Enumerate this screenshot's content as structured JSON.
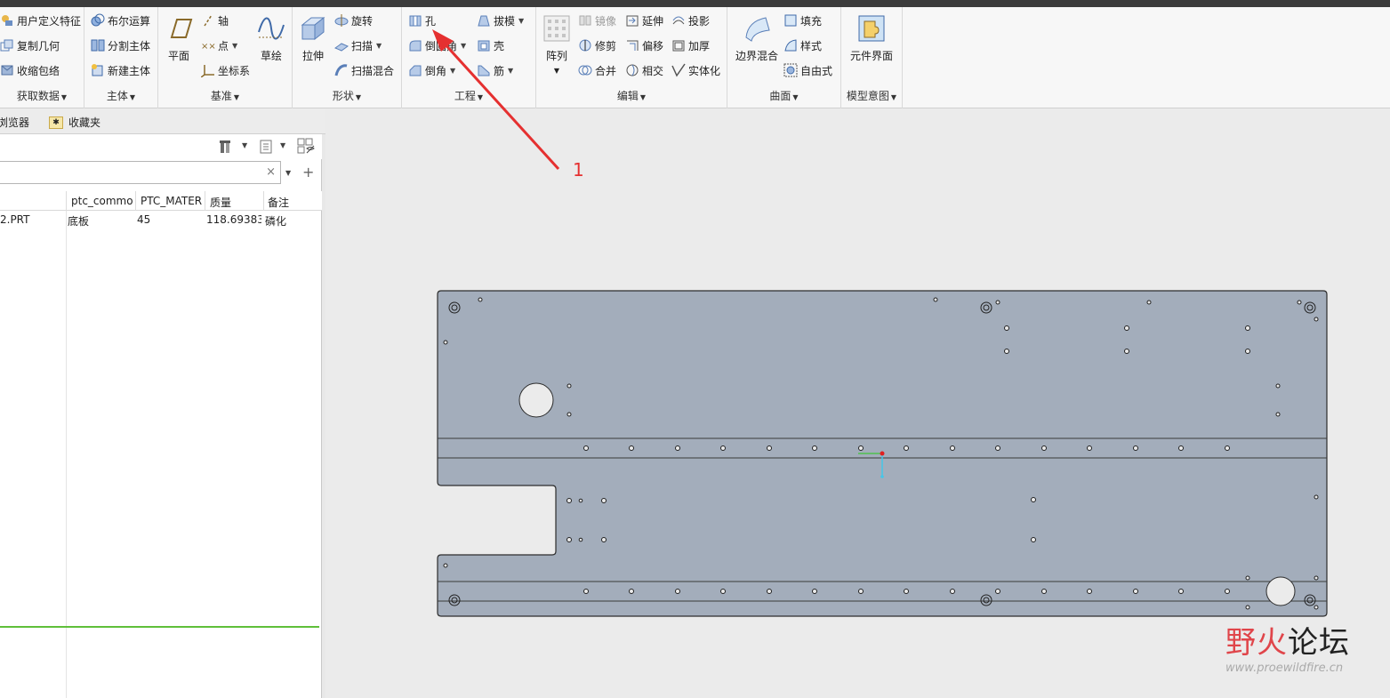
{
  "ribbon": {
    "get_data": {
      "label": "获取数据",
      "items": [
        "用户定义特征",
        "复制几何",
        "收缩包络"
      ]
    },
    "body": {
      "label": "主体",
      "items": [
        "布尔运算",
        "分割主体",
        "新建主体"
      ]
    },
    "datum": {
      "label": "基准",
      "plane": "平面",
      "axis": "轴",
      "point": "点",
      "csys": "坐标系",
      "sketch": "草绘"
    },
    "shapes": {
      "label": "形状",
      "extrude": "拉伸",
      "revolve": "旋转",
      "sweep": "扫描",
      "swept_blend": "扫描混合"
    },
    "engineering": {
      "label": "工程",
      "hole": "孔",
      "round": "倒圆角",
      "chamfer": "倒角",
      "draft": "拔模",
      "shell": "壳",
      "rib": "筋"
    },
    "editing": {
      "label": "编辑",
      "pattern": "阵列",
      "mirror": "镜像",
      "trim": "修剪",
      "merge": "合并",
      "extend": "延伸",
      "offset": "偏移",
      "intersect": "相交",
      "project": "投影",
      "thicken": "加厚",
      "solidify": "实体化"
    },
    "surfaces": {
      "label": "曲面",
      "boundary_blend": "边界混合",
      "fill": "填充",
      "style": "样式",
      "freestyle": "自由式"
    },
    "model_intent": {
      "label": "模型意图",
      "component_interface": "元件界面"
    }
  },
  "panel": {
    "tab_browser": "浏览器",
    "tab_favorites": "收藏夹",
    "search_clear": "×",
    "columns": [
      "ptc_commo",
      "PTC_MATER",
      "质量",
      "备注"
    ],
    "row": {
      "name": "2.PRT",
      "ptc_common": "底板",
      "material": "45",
      "mass": "118.69383",
      "note": "磷化"
    }
  },
  "canvas": {
    "annotation": "1"
  },
  "watermark": {
    "title_red": "野火",
    "title_black": "论坛",
    "url": "www.proewildfire.cn"
  },
  "colors": {
    "part_fill": "#a3adbb",
    "annotation_red": "#e53030",
    "highlight_green": "#5fbf3a"
  }
}
